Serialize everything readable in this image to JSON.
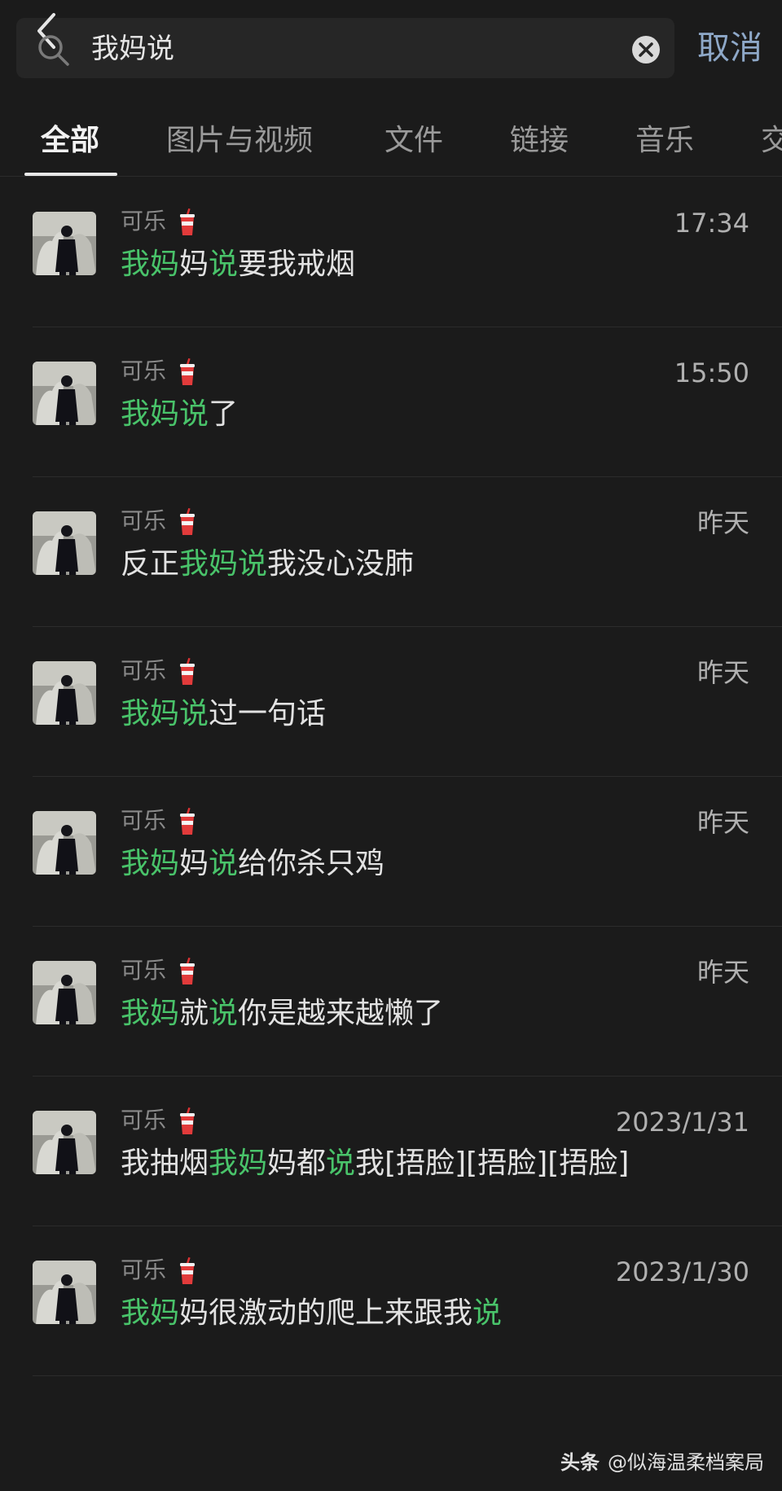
{
  "search": {
    "query": "我妈说",
    "cancel_label": "取消"
  },
  "tabs": [
    {
      "label": "全部",
      "active": true
    },
    {
      "label": "图片与视频"
    },
    {
      "label": "文件"
    },
    {
      "label": "链接"
    },
    {
      "label": "音乐"
    },
    {
      "label": "交"
    }
  ],
  "results": [
    {
      "sender": "可乐",
      "time": "17:34",
      "segments": [
        {
          "t": "我妈",
          "hl": true
        },
        {
          "t": "妈",
          "hl": false
        },
        {
          "t": "说",
          "hl": true
        },
        {
          "t": "要我戒烟",
          "hl": false
        }
      ]
    },
    {
      "sender": "可乐",
      "time": "15:50",
      "segments": [
        {
          "t": "我妈说",
          "hl": true
        },
        {
          "t": "了",
          "hl": false
        }
      ]
    },
    {
      "sender": "可乐",
      "time": "昨天",
      "segments": [
        {
          "t": "反正",
          "hl": false
        },
        {
          "t": "我妈说",
          "hl": true
        },
        {
          "t": "我没心没肺",
          "hl": false
        }
      ]
    },
    {
      "sender": "可乐",
      "time": "昨天",
      "segments": [
        {
          "t": "我妈说",
          "hl": true
        },
        {
          "t": "过一句话",
          "hl": false
        }
      ]
    },
    {
      "sender": "可乐",
      "time": "昨天",
      "segments": [
        {
          "t": "我妈",
          "hl": true
        },
        {
          "t": "妈",
          "hl": false
        },
        {
          "t": "说",
          "hl": true
        },
        {
          "t": "给你杀只鸡",
          "hl": false
        }
      ]
    },
    {
      "sender": "可乐",
      "time": "昨天",
      "segments": [
        {
          "t": "我妈",
          "hl": true
        },
        {
          "t": "就",
          "hl": false
        },
        {
          "t": "说",
          "hl": true
        },
        {
          "t": "你是越来越懒了",
          "hl": false
        }
      ]
    },
    {
      "sender": "可乐",
      "time": "2023/1/31",
      "segments": [
        {
          "t": "我抽烟",
          "hl": false
        },
        {
          "t": "我妈",
          "hl": true
        },
        {
          "t": "妈都",
          "hl": false
        },
        {
          "t": "说",
          "hl": true
        },
        {
          "t": "我[捂脸][捂脸][捂脸]",
          "hl": false
        }
      ]
    },
    {
      "sender": "可乐",
      "time": "2023/1/30",
      "segments": [
        {
          "t": "我妈",
          "hl": true
        },
        {
          "t": "妈很激动的爬上来跟我",
          "hl": false
        },
        {
          "t": "说",
          "hl": true
        }
      ]
    }
  ],
  "colors": {
    "background": "#1b1b1b",
    "highlight": "#49c36a",
    "cancel": "#8ea8c8"
  },
  "watermark": {
    "brand": "头条",
    "handle": "@似海温柔档案局"
  }
}
